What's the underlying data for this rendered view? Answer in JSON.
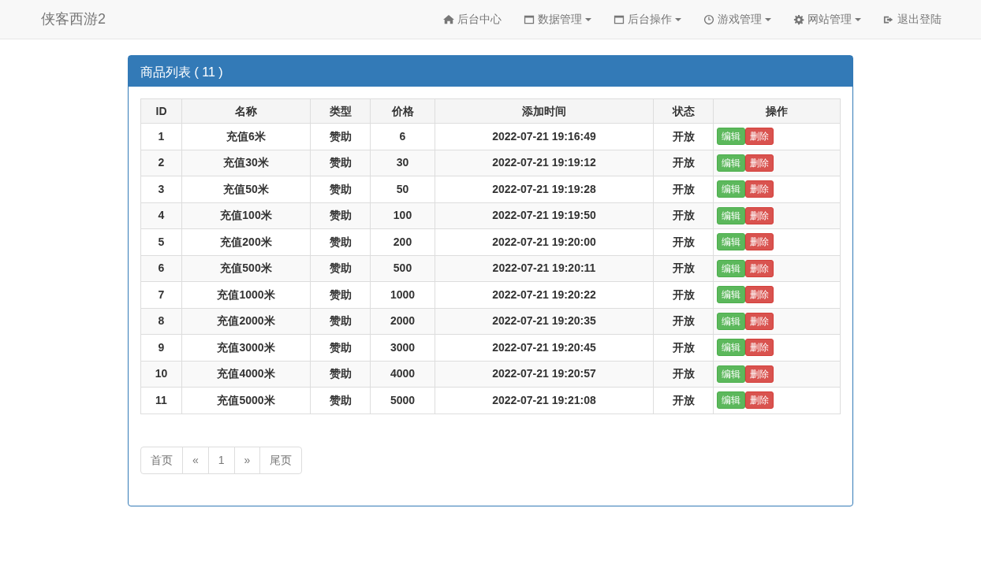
{
  "brand": "侠客西游2",
  "nav": [
    {
      "label": "后台中心",
      "kind": "home",
      "dropdown": false
    },
    {
      "label": "数据管理",
      "kind": "data",
      "dropdown": true
    },
    {
      "label": "后台操作",
      "kind": "operate",
      "dropdown": true
    },
    {
      "label": "游戏管理",
      "kind": "game",
      "dropdown": true
    },
    {
      "label": "网站管理",
      "kind": "site",
      "dropdown": true
    },
    {
      "label": "退出登陆",
      "kind": "logout",
      "dropdown": false
    }
  ],
  "panel": {
    "title": "商品列表 ( 11 )"
  },
  "table": {
    "columns": [
      "ID",
      "名称",
      "类型",
      "价格",
      "添加时间",
      "状态",
      "操作"
    ],
    "rows": [
      {
        "cells": [
          "1",
          "充值6米",
          "赞助",
          "6",
          "2022-07-21 19:16:49",
          "开放"
        ],
        "actions": [
          "编辑",
          "删除"
        ]
      },
      {
        "cells": [
          "2",
          "充值30米",
          "赞助",
          "30",
          "2022-07-21 19:19:12",
          "开放"
        ],
        "actions": [
          "编辑",
          "删除"
        ]
      },
      {
        "cells": [
          "3",
          "充值50米",
          "赞助",
          "50",
          "2022-07-21 19:19:28",
          "开放"
        ],
        "actions": [
          "编辑",
          "删除"
        ]
      },
      {
        "cells": [
          "4",
          "充值100米",
          "赞助",
          "100",
          "2022-07-21 19:19:50",
          "开放"
        ],
        "actions": [
          "编辑",
          "删除"
        ]
      },
      {
        "cells": [
          "5",
          "充值200米",
          "赞助",
          "200",
          "2022-07-21 19:20:00",
          "开放"
        ],
        "actions": [
          "编辑",
          "删除"
        ]
      },
      {
        "cells": [
          "6",
          "充值500米",
          "赞助",
          "500",
          "2022-07-21 19:20:11",
          "开放"
        ],
        "actions": [
          "编辑",
          "删除"
        ]
      },
      {
        "cells": [
          "7",
          "充值1000米",
          "赞助",
          "1000",
          "2022-07-21 19:20:22",
          "开放"
        ],
        "actions": [
          "编辑",
          "删除"
        ]
      },
      {
        "cells": [
          "8",
          "充值2000米",
          "赞助",
          "2000",
          "2022-07-21 19:20:35",
          "开放"
        ],
        "actions": [
          "编辑",
          "删除"
        ]
      },
      {
        "cells": [
          "9",
          "充值3000米",
          "赞助",
          "3000",
          "2022-07-21 19:20:45",
          "开放"
        ],
        "actions": [
          "编辑",
          "删除"
        ]
      },
      {
        "cells": [
          "10",
          "充值4000米",
          "赞助",
          "4000",
          "2022-07-21 19:20:57",
          "开放"
        ],
        "actions": [
          "编辑",
          "删除"
        ]
      },
      {
        "cells": [
          "11",
          "充值5000米",
          "赞助",
          "5000",
          "2022-07-21 19:21:08",
          "开放"
        ],
        "actions": [
          "编辑",
          "删除"
        ]
      }
    ]
  },
  "pagination": [
    "首页",
    "«",
    "1",
    "»",
    "尾页"
  ]
}
